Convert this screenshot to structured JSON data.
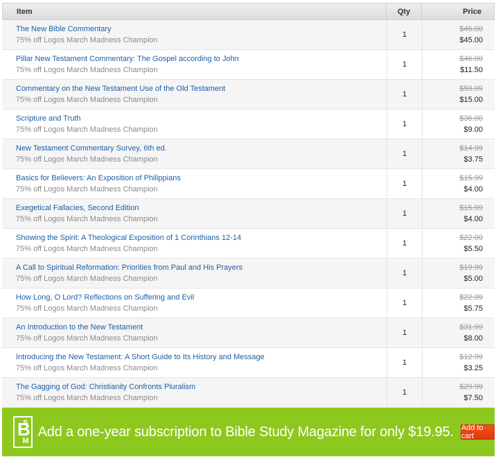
{
  "header": {
    "item": "Item",
    "qty": "Qty",
    "price": "Price"
  },
  "items": [
    {
      "title": "The New Bible Commentary",
      "promo": "75% off Logos March Madness Champion",
      "qty": "1",
      "orig": "$45.00",
      "price": "$45.00"
    },
    {
      "title": "Pillar New Testament Commentary: The Gospel according to John",
      "promo": "75% off Logos March Madness Champion",
      "qty": "1",
      "orig": "$46.00",
      "price": "$11.50"
    },
    {
      "title": "Commentary on the New Testament Use of the Old Testament",
      "promo": "75% off Logos March Madness Champion",
      "qty": "1",
      "orig": "$59.99",
      "price": "$15.00"
    },
    {
      "title": "Scripture and Truth",
      "promo": "75% off Logos March Madness Champion",
      "qty": "1",
      "orig": "$36.00",
      "price": "$9.00"
    },
    {
      "title": "New Testament Commentary Survey, 6th ed.",
      "promo": "75% off Logos March Madness Champion",
      "qty": "1",
      "orig": "$14.99",
      "price": "$3.75"
    },
    {
      "title": "Basics for Believers: An Exposition of Philippians",
      "promo": "75% off Logos March Madness Champion",
      "qty": "1",
      "orig": "$15.99",
      "price": "$4.00"
    },
    {
      "title": "Exegetical Fallacies, Second Edition",
      "promo": "75% off Logos March Madness Champion",
      "qty": "1",
      "orig": "$15.99",
      "price": "$4.00"
    },
    {
      "title": "Showing the Spirit: A Theological Exposition of 1 Corinthians 12-14",
      "promo": "75% off Logos March Madness Champion",
      "qty": "1",
      "orig": "$22.00",
      "price": "$5.50"
    },
    {
      "title": "A Call to Spiritual Reformation: Priorities from Paul and His Prayers",
      "promo": "75% off Logos March Madness Champion",
      "qty": "1",
      "orig": "$19.99",
      "price": "$5.00"
    },
    {
      "title": "How Long, O Lord? Reflections on Suffering and Evil",
      "promo": "75% off Logos March Madness Champion",
      "qty": "1",
      "orig": "$22.99",
      "price": "$5.75"
    },
    {
      "title": "An Introduction to the New Testament",
      "promo": "75% off Logos March Madness Champion",
      "qty": "1",
      "orig": "$31.99",
      "price": "$8.00"
    },
    {
      "title": "Introducing the New Testament: A Short Guide to Its History and Message",
      "promo": "75% off Logos March Madness Champion",
      "qty": "1",
      "orig": "$12.99",
      "price": "$3.25"
    },
    {
      "title": "The Gagging of God: Christianity Confronts Pluralism",
      "promo": "75% off Logos March Madness Champion",
      "qty": "1",
      "orig": "$29.99",
      "price": "$7.50"
    }
  ],
  "banner": {
    "logo_b": "B",
    "logo_s": "S",
    "logo_m": "M",
    "text": "Add a one-year subscription to Bible Study Magazine for only $19.95.",
    "button": "Add to cart",
    "color": "#8dc81f",
    "button_color": "#e8461a"
  },
  "colors": {
    "link": "#1b5fa6",
    "muted": "#8a8a8a"
  }
}
